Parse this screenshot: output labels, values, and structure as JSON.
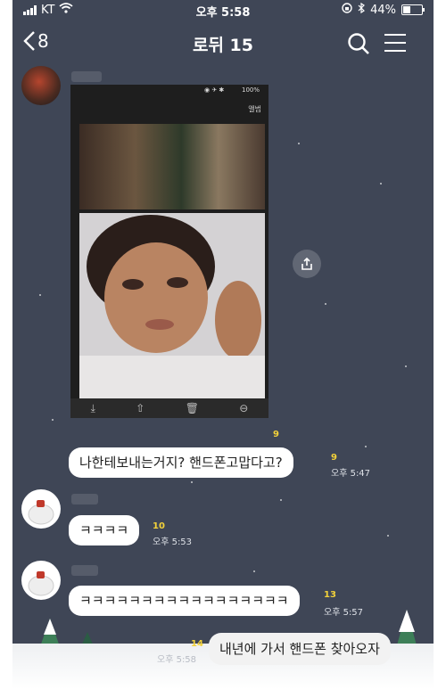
{
  "status": {
    "carrier": "KT",
    "time": "오후 5:58",
    "battery": "44%",
    "battery_level": 0.44
  },
  "header": {
    "back_count": "8",
    "title": "로뒤 15"
  },
  "photo": {
    "battery_text": "100%",
    "album_label": "앨범",
    "unread": "9"
  },
  "messages": [
    {
      "text": "나한테보내는거지? 핸드폰고맙다고?",
      "unread": "9",
      "time": "오후 5:47"
    },
    {
      "text": "ㅋㅋㅋㅋ",
      "unread": "10",
      "time": "오후 5:53"
    },
    {
      "text": "ㅋㅋㅋㅋㅋㅋㅋㅋㅋㅋㅋㅋㅋㅋㅋㅋㅋ",
      "unread": "13",
      "time": "오후 5:57"
    },
    {
      "text": "내년에 가서 핸드폰 찾아오자",
      "unread": "14",
      "time": "오후 5:58"
    }
  ],
  "colors": {
    "background": "#3f4656",
    "bubble": "#ffffff",
    "unread": "#f3d23a"
  }
}
